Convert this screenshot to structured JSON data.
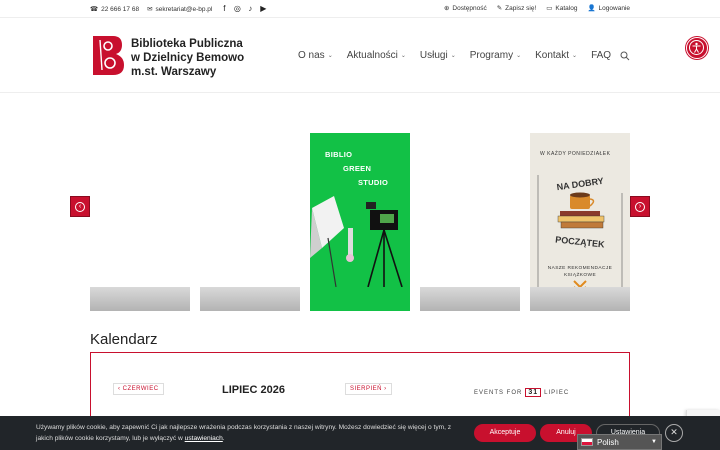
{
  "topbar": {
    "phone": "22 666 17 68",
    "email": "sekretariat@e-bp.pl",
    "links": [
      "Dostępność",
      "Zapisz się!",
      "Katalog",
      "Logowanie"
    ]
  },
  "header": {
    "logo_line1": "Biblioteka Publiczna",
    "logo_line2": "w Dzielnicy Bemowo",
    "logo_line3": "m.st. Warszawy",
    "nav": [
      {
        "label": "O nas",
        "has_dropdown": true
      },
      {
        "label": "Aktualności",
        "has_dropdown": true
      },
      {
        "label": "Usługi",
        "has_dropdown": true
      },
      {
        "label": "Programy",
        "has_dropdown": true
      },
      {
        "label": "Kontakt",
        "has_dropdown": true
      },
      {
        "label": "FAQ",
        "has_dropdown": false
      }
    ]
  },
  "slides": {
    "green_lines": [
      "BIBLIO",
      "GREEN",
      "STUDIO"
    ],
    "book_top": "W KAŻDY PONIEDZIAŁEK",
    "book_title1": "NA DOBRY",
    "book_title2": "POCZĄTEK",
    "book_bottom1": "NASZE REKOMENDACJE",
    "book_bottom2": "KSIĄŻKOWE"
  },
  "calendar": {
    "heading": "Kalendarz",
    "prev": "CZERWIEC",
    "month": "LIPIEC 2026",
    "next": "SIERPIEŃ",
    "events_for": "EVENTS FOR",
    "day": "31",
    "events_month": "LIPIEC"
  },
  "cookie": {
    "text_main": "Używamy plików cookie, aby zapewnić Ci jak najlepsze wrażenia podczas korzystania z naszej witryny. Możesz dowiedzieć się więcej o tym, z jakich plików cookie korzystamy, lub je wyłączyć w ",
    "link": "ustawieniach",
    "text_end": ".",
    "accept": "Akceptuje",
    "reject": "Anuluj",
    "settings": "Ustawienia",
    "close": "✕"
  },
  "language": {
    "selected": "Polish"
  },
  "colors": {
    "accent": "#c8102e",
    "green": "#12c146",
    "cookie_bg": "#212529"
  }
}
